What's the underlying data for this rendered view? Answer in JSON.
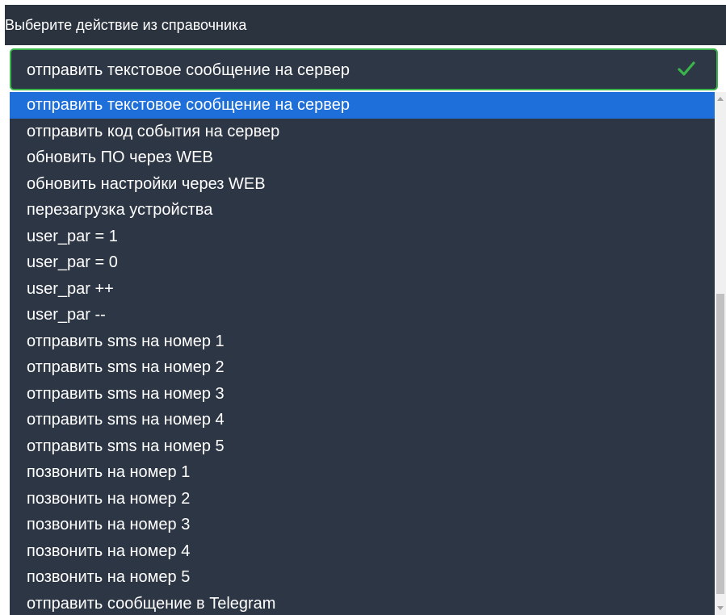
{
  "header": {
    "title": "Выберите действие из справочника"
  },
  "select": {
    "value": "отправить текстовое сообщение на сервер",
    "valid_icon": "check-icon",
    "border_color": "#39b54a"
  },
  "dropdown": {
    "selected_index": 0,
    "highlight_color": "#1e6fd9",
    "options": [
      "отправить текстовое сообщение на сервер",
      "отправить код события на сервер",
      "обновить ПО через WEB",
      "обновить настройки через WEB",
      "перезагрузка устройства",
      "user_par = 1",
      "user_par = 0",
      "user_par ++",
      "user_par --",
      "отправить sms на номер 1",
      "отправить sms на номер 2",
      "отправить sms на номер 3",
      "отправить sms на номер 4",
      "отправить sms на номер 5",
      "позвонить на номер 1",
      "позвонить на номер 2",
      "позвонить на номер 3",
      "позвонить на номер 4",
      "позвонить на номер 5",
      "отправить сообщение в Telegram"
    ]
  }
}
